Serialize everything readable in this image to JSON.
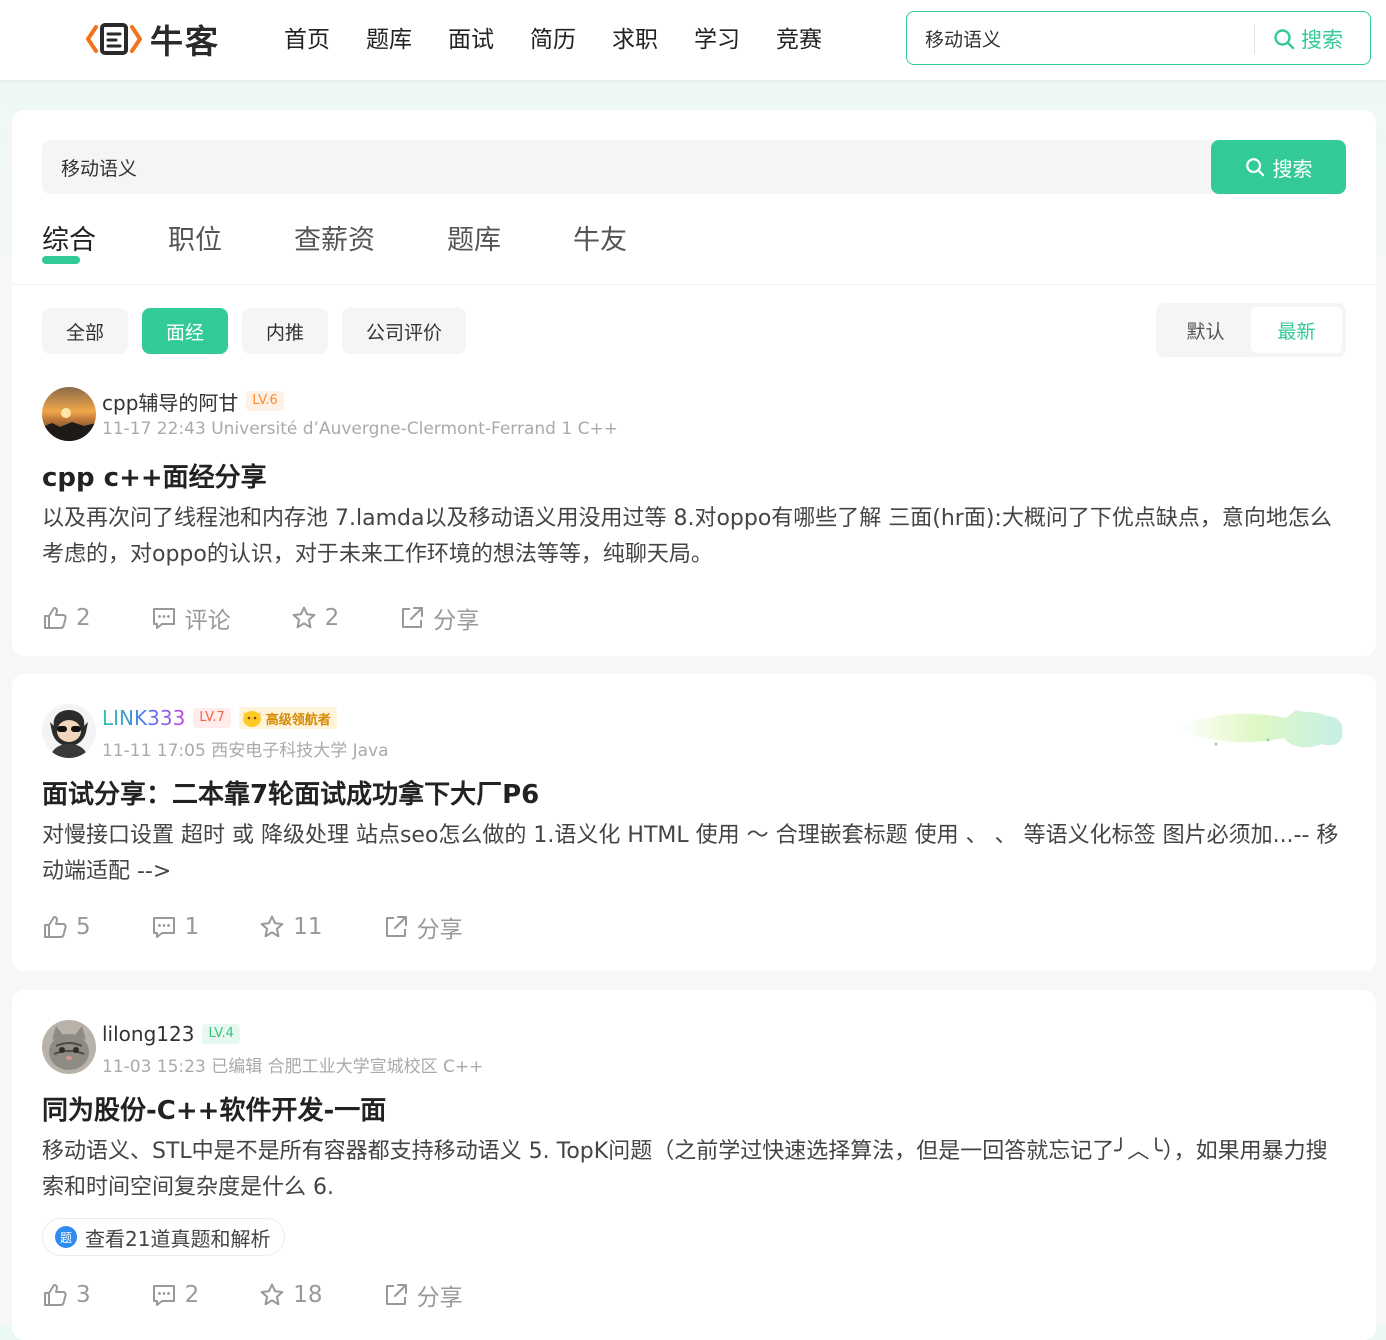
{
  "nav": {
    "brand": "牛客",
    "links": [
      "首页",
      "题库",
      "面试",
      "简历",
      "求职",
      "学习",
      "竞赛"
    ],
    "search_value": "移动语义",
    "search_button": "搜索"
  },
  "search": {
    "query": "移动语义",
    "button": "搜索"
  },
  "tabs": [
    "综合",
    "职位",
    "查薪资",
    "题库",
    "牛友"
  ],
  "filters": [
    "全部",
    "面经",
    "内推",
    "公司评价"
  ],
  "sort": {
    "default": "默认",
    "latest": "最新"
  },
  "posts": [
    {
      "author": "cpp辅导的阿甘",
      "level": "LV.6",
      "meta": "11-17 22:43   Université d’Auvergne-Clermont-Ferrand 1 C++",
      "title": "cpp c++面经分享",
      "body": "以及再次问了线程池和内存池 7.lamda以及移动语义用没用过等 8.对oppo有哪些了解 三面(hr面):大概问了下优点缺点，意向地怎么考虑的，对oppo的认识，对于未来工作环境的想法等等，纯聊天局。",
      "likes": "2",
      "comments": "评论",
      "stars": "2",
      "share": "分享"
    },
    {
      "author": "LINK333",
      "level": "LV.7",
      "medal": "高级领航者",
      "meta": "11-11 17:05   西安电子科技大学 Java",
      "title": "面试分享：二本靠7轮面试成功拿下大厂P6",
      "body": "对慢接口设置 超时 或 降级处理 站点seo怎么做的 1.语义化 HTML 使用 ～ 合理嵌套标题 使用 、 、 等语义化标签 图片必须加...-- 移动端适配 -->",
      "likes": "5",
      "comments": "1",
      "stars": "11",
      "share": "分享"
    },
    {
      "author": "lilong123",
      "level": "LV.4",
      "meta": "11-03 15:23   已编辑   合肥工业大学宣城校区 C++",
      "title": "同为股份-C++软件开发-一面",
      "body": "移动语义、STL中是不是所有容器都支持移动语义 5. TopK问题（之前学过快速选择算法，但是一回答就忘记了╯︿╰），如果用暴力搜索和时间空间复杂度是什么 6.",
      "tag_icon": "题",
      "tag": "查看21道真题和解析",
      "likes": "3",
      "comments": "2",
      "stars": "18",
      "share": "分享"
    }
  ],
  "colors": {
    "accent": "#32ca99",
    "text": "#222222",
    "muted": "#999999"
  }
}
